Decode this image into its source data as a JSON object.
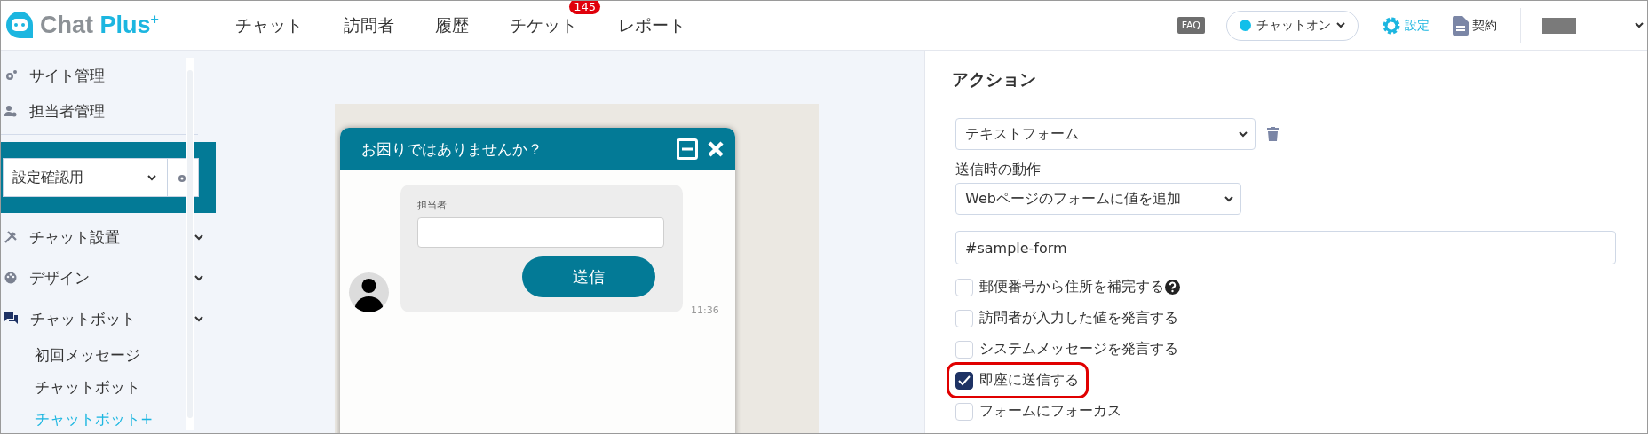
{
  "header": {
    "logo": {
      "first": "Chat",
      "second": "Plus",
      "sup": "+"
    },
    "nav": [
      {
        "label": "チャット"
      },
      {
        "label": "訪問者"
      },
      {
        "label": "履歴"
      },
      {
        "label": "チケット",
        "badge": "145"
      },
      {
        "label": "レポート"
      }
    ],
    "faq": "FAQ",
    "status": {
      "label": "チャットオン",
      "on": true
    },
    "settings": "設定",
    "contract": "契約"
  },
  "sidebar": {
    "top_items": [
      {
        "label": "サイト管理",
        "kind": "site"
      },
      {
        "label": "担当者管理",
        "kind": "staff"
      }
    ],
    "site_select": {
      "value": "設定確認用"
    },
    "sections": [
      {
        "label": "チャット設置",
        "kind": "tools"
      },
      {
        "label": "デザイン",
        "kind": "palette"
      },
      {
        "label": "チャットボット",
        "kind": "chat",
        "children": [
          {
            "label": "初回メッセージ",
            "selected": false
          },
          {
            "label": "チャットボット",
            "selected": false
          },
          {
            "label": "チャットボット+",
            "selected": true
          }
        ]
      }
    ]
  },
  "preview": {
    "title": "お困りではありませんか？",
    "field_label": "担当者",
    "button": "送信",
    "time": "11:36"
  },
  "panel": {
    "heading": "アクション",
    "action_select": "テキストフォーム",
    "submit_label": "送信時の動作",
    "submit_select": "Webページのフォームに値を追加",
    "selector_value": "#sample-form",
    "options": [
      {
        "label": "郵便番号から住所を補完する",
        "checked": false,
        "help": true,
        "highlighted": false
      },
      {
        "label": "訪問者が入力した値を発言する",
        "checked": false,
        "help": false,
        "highlighted": false
      },
      {
        "label": "システムメッセージを発言する",
        "checked": false,
        "help": false,
        "highlighted": false
      },
      {
        "label": "即座に送信する",
        "checked": true,
        "help": false,
        "highlighted": true
      },
      {
        "label": "フォームにフォーカス",
        "checked": false,
        "help": false,
        "highlighted": false
      }
    ]
  }
}
